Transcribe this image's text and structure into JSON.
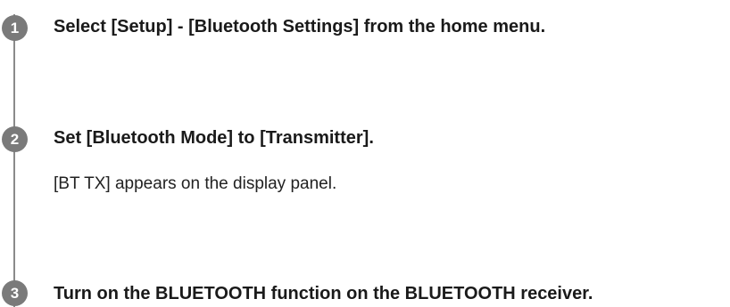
{
  "steps": [
    {
      "number": "1",
      "heading": "Select [Setup] - [Bluetooth Settings] from the home menu.",
      "body": ""
    },
    {
      "number": "2",
      "heading": "Set [Bluetooth Mode] to [Transmitter].",
      "body": "[BT TX] appears on the display panel."
    },
    {
      "number": "3",
      "heading": "Turn on the BLUETOOTH function on the BLUETOOTH receiver.",
      "body": ""
    }
  ]
}
